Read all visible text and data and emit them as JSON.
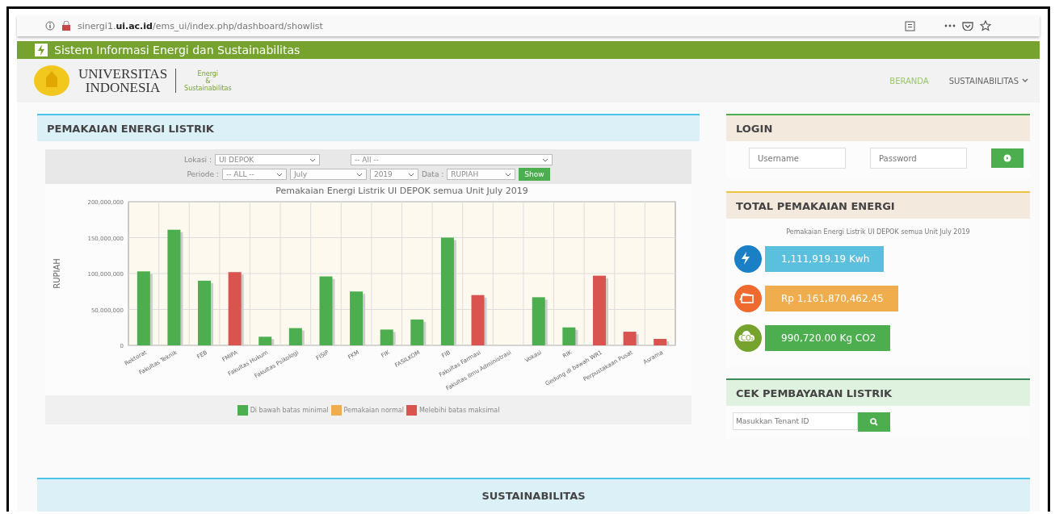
{
  "browser": {
    "url": "sinergi1.**ui.ac.id**/ems_ui/index.php/dashboard/showlist"
  },
  "site": {
    "title": "Sistem Informasi Energi dan Sustainabilitas",
    "logo_lines": [
      "UNIVERSITAS",
      "INDONESIA"
    ],
    "subtitle_lines": [
      "Energi",
      "&",
      "Sustainabilitas"
    ]
  },
  "nav": [
    {
      "label": "BERANDA",
      "selected": true,
      "dropdown": false
    },
    {
      "label": "SUSTAINABILITAS",
      "selected": false,
      "dropdown": true
    }
  ],
  "usage_panel": {
    "title": "PEMAKAIAN ENERGI LISTRIK",
    "filters": {
      "lokasi_label": "Lokasi :",
      "lokasi": "UI DEPOK",
      "unit": "-- All --",
      "periode_label": "Periode :",
      "periode": "-- ALL --",
      "month": "July",
      "year": "2019",
      "data_label": "Data :",
      "data": "RUPIAH",
      "button": "Show"
    },
    "chart_data": {
      "type": "bar",
      "title": "Pemakaian Energi Listrik UI DEPOK semua Unit July 2019",
      "ylabel": "RUPIAH",
      "categories": [
        "Rektorat",
        "Fakultas Teknik",
        "FEB",
        "FMIPA",
        "Fakultas Hukum",
        "Fakultas Psikologi",
        "FISIP",
        "FKM",
        "FIK",
        "FASILKOM",
        "FIB",
        "Fakultas Farmasi",
        "Fakultas Ilmu Administrasi",
        "Vokasi",
        "RIK",
        "Gedung di bawah WR1",
        "Perpustakaan Pusat",
        "Asrama"
      ],
      "ylim": [
        0,
        200000000
      ],
      "grid": true,
      "yticks": [
        {
          "value": 0,
          "label": "0"
        },
        {
          "value": 50000000,
          "label": "50,000,000"
        },
        {
          "value": 100000000,
          "label": "100,000,000"
        },
        {
          "value": 150000000,
          "label": "150,000,000"
        },
        {
          "value": 200000000,
          "label": "200,000,000"
        }
      ],
      "series": [
        {
          "name": "Di bawah batas minimal",
          "color": "#4cae4f",
          "values": [
            103000000,
            161000000,
            90000000,
            null,
            12000000,
            24000000,
            96000000,
            75000000,
            22000000,
            36000000,
            150000000,
            null,
            null,
            67000000,
            25000000,
            null,
            null,
            null
          ]
        },
        {
          "name": "Pemakaian normal",
          "color": "#f0ad4e",
          "values": [
            null,
            null,
            null,
            null,
            null,
            null,
            null,
            null,
            null,
            null,
            null,
            null,
            null,
            null,
            null,
            null,
            null,
            null
          ]
        },
        {
          "name": "Melebihi batas maksimal",
          "color": "#d9534f",
          "values": [
            null,
            null,
            null,
            102000000,
            null,
            null,
            null,
            null,
            null,
            null,
            null,
            70000000,
            null,
            null,
            null,
            97000000,
            19000000,
            9000000
          ]
        }
      ]
    }
  },
  "login": {
    "title": "LOGIN",
    "username_placeholder": "Username",
    "password_placeholder": "Password"
  },
  "total": {
    "title": "TOTAL PEMAKAIAN ENERGI",
    "caption": "Pemakaian Energi Listrik UI DEPOK semua Unit July 2019",
    "stats": [
      {
        "kind": "energy",
        "value": "1,111,919.19 Kwh"
      },
      {
        "kind": "cost",
        "value": "Rp 1,161,870,462.45"
      },
      {
        "kind": "carbon",
        "icon_text": "CO₂",
        "value": "990,720.00 Kg CO2"
      }
    ]
  },
  "payment": {
    "title": "CEK PEMBAYARAN LISTRIK",
    "placeholder": "Masukkan Tenant ID"
  },
  "bottom": {
    "title": "SUSTAINABILITAS"
  }
}
